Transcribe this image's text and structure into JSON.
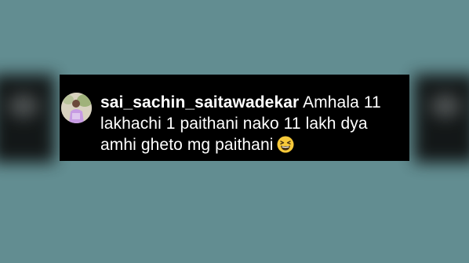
{
  "comment": {
    "username": "sai_sachin_saitawadekar",
    "text": "Amhala 11 lakhachi 1 paithani nako 11 lakh dya amhi gheto mg paithani",
    "emoji_icon": "grinning-squinting-face-icon"
  },
  "colors": {
    "background": "#628d91",
    "card": "#000000",
    "text": "#ffffff"
  }
}
